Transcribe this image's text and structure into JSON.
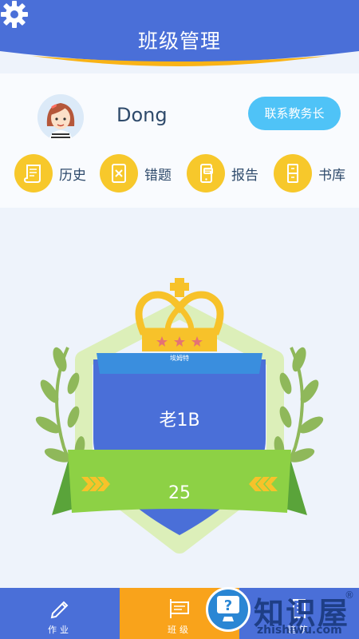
{
  "header": {
    "title": "班级管理"
  },
  "profile": {
    "username": "Dong",
    "contact_label": "联系教务长"
  },
  "shortcuts": [
    {
      "label": "历史",
      "icon": "scroll-icon"
    },
    {
      "label": "错题",
      "icon": "wrong-paper-icon"
    },
    {
      "label": "报告",
      "icon": "phone-report-icon"
    },
    {
      "label": "书库",
      "icon": "bookshelf-icon"
    }
  ],
  "badge": {
    "subtitle": "埃姆特",
    "class_name": "老1B",
    "count": "25"
  },
  "tabs": [
    {
      "label": "作业",
      "icon": "pencil-icon",
      "active": false
    },
    {
      "label": "班级",
      "icon": "class-board-icon",
      "active": true
    },
    {
      "label": "建筑",
      "icon": "building-icon",
      "active": false
    }
  ],
  "watermark": {
    "brand": "知识屋",
    "domain": "zhishiwu.com",
    "registered": "®"
  },
  "colors": {
    "primary": "#4a6fd8",
    "accent": "#f9a31b",
    "badge_blue": "#4a6fd8",
    "ribbon_green": "#8dd145",
    "crown_gold": "#f7c22a"
  }
}
